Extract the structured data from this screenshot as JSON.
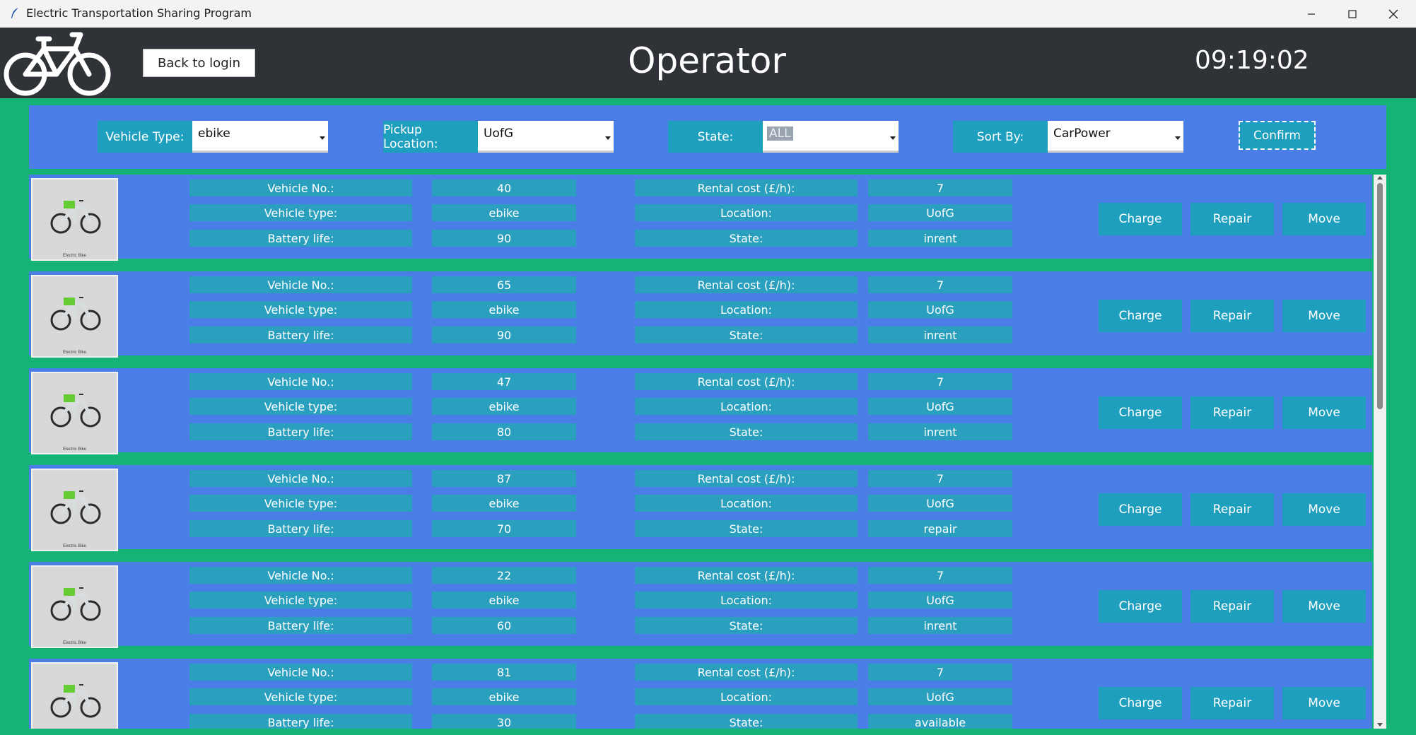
{
  "window": {
    "title": "Electric Transportation Sharing Program"
  },
  "header": {
    "back_label": "Back to login",
    "title": "Operator",
    "clock": "09:19:02"
  },
  "filters": {
    "vehicle_type_label": "Vehicle Type:",
    "vehicle_type_value": "ebike",
    "pickup_label": "Pickup Location:",
    "pickup_value": "UofG",
    "state_label": "State:",
    "state_value": "ALL",
    "sort_label": "Sort By:",
    "sort_value": "CarPower",
    "confirm_label": "Confirm"
  },
  "labels": {
    "vehicle_no": "Vehicle No.:",
    "vehicle_type": "Vehicle type:",
    "battery": "Battery life:",
    "rental": "Rental cost (£/h):",
    "location": "Location:",
    "state": "State:",
    "image_caption": "Electric Bike"
  },
  "actions": {
    "charge": "Charge",
    "repair": "Repair",
    "move": "Move"
  },
  "vehicles": [
    {
      "no": "40",
      "type": "ebike",
      "battery": "90",
      "cost": "7",
      "location": "UofG",
      "state": "inrent"
    },
    {
      "no": "65",
      "type": "ebike",
      "battery": "90",
      "cost": "7",
      "location": "UofG",
      "state": "inrent"
    },
    {
      "no": "47",
      "type": "ebike",
      "battery": "80",
      "cost": "7",
      "location": "UofG",
      "state": "inrent"
    },
    {
      "no": "87",
      "type": "ebike",
      "battery": "70",
      "cost": "7",
      "location": "UofG",
      "state": "repair"
    },
    {
      "no": "22",
      "type": "ebike",
      "battery": "60",
      "cost": "7",
      "location": "UofG",
      "state": "inrent"
    },
    {
      "no": "81",
      "type": "ebike",
      "battery": "30",
      "cost": "7",
      "location": "UofG",
      "state": "available"
    }
  ]
}
